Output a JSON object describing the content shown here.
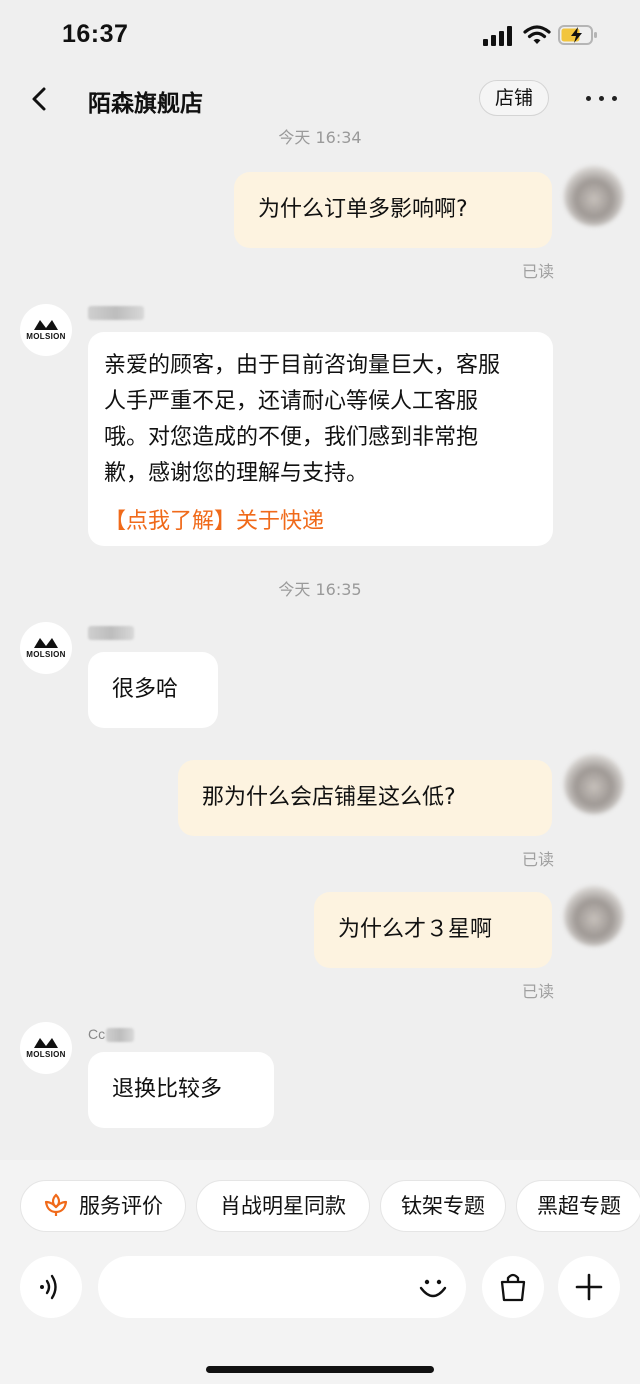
{
  "status": {
    "time": "16:37"
  },
  "header": {
    "title": "陌森旗舰店",
    "shop_button": "店铺",
    "more_icon": "more-icon"
  },
  "brand": {
    "avatar_text": "MOLSION",
    "accent": "#f06a1a",
    "bubble_out": "#fdf3e0",
    "bubble_in": "#ffffff"
  },
  "chat": {
    "ts_top": "今天 16:34",
    "msg1": "为什么订单多影响啊?",
    "read_label": "已读",
    "reply1_lines": [
      "亲爱的顾客，由于目前咨询量巨大，客服",
      "人手严重不足，还请耐心等候人工客服",
      "哦。对您造成的不便，我们感到非常抱",
      "歉，感谢您的理解与支持。"
    ],
    "reply1_link": "【点我了解】关于快递",
    "ts_mid": "今天 16:35",
    "reply2": "很多哈",
    "msg2": "那为什么会店铺星这么低?",
    "msg3": "为什么才３星啊",
    "nick3": "Cc",
    "reply3": "退换比较多"
  },
  "quick_replies": [
    "服务评价",
    "肖战明星同款",
    "钛架专题",
    "黑超专题"
  ],
  "input": {
    "voice_icon": "voice-icon",
    "emoji_icon": "emoji-icon",
    "bag_icon": "bag-icon",
    "plus_icon": "plus-icon"
  }
}
